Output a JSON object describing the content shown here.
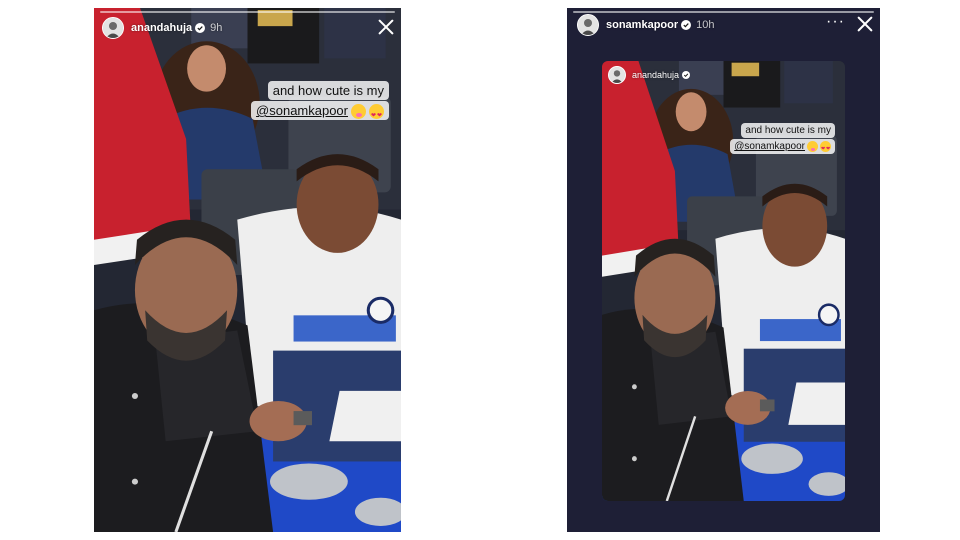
{
  "left_story": {
    "username": "anandahuja",
    "verified": true,
    "timestamp": "9h",
    "caption_line1": "and how cute is my",
    "mention": "@sonamkapoor",
    "emojis": [
      "smiling-face-with-hearts-emoji",
      "heart-eyes-emoji"
    ],
    "icons": [
      "avatar",
      "verified-badge-icon",
      "close-icon"
    ]
  },
  "right_story": {
    "username": "sonamkapoor",
    "verified": true,
    "timestamp": "10h",
    "icons": [
      "avatar",
      "verified-badge-icon",
      "more-options-icon",
      "close-icon"
    ],
    "shared_post": {
      "username": "anandahuja",
      "caption_line1": "and how cute is my",
      "mention": "@sonamkapoor",
      "emojis": [
        "smiling-face-with-hearts-emoji",
        "heart-eyes-emoji"
      ]
    }
  },
  "colors": {
    "story_background": "#1e1f36",
    "stadium_blue": "#1f49c7",
    "jacket_dark": "#1c1c1f"
  }
}
